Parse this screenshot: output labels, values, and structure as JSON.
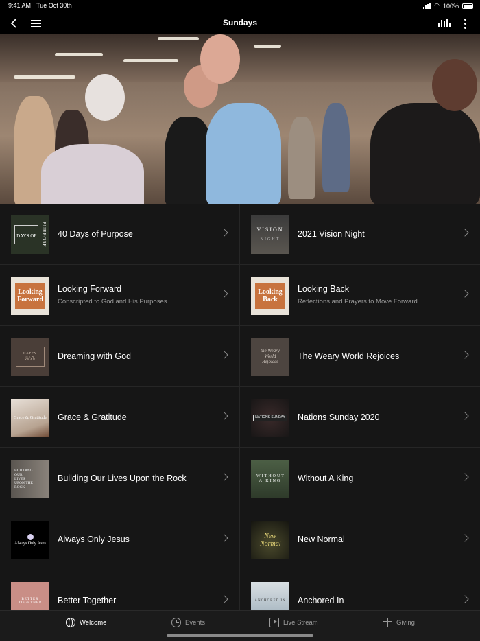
{
  "status_bar": {
    "time": "9:41 AM",
    "date": "Tue Oct 30th",
    "battery": "100%"
  },
  "nav": {
    "title": "Sundays"
  },
  "items": [
    {
      "title": "40 Days of Purpose",
      "subtitle": ""
    },
    {
      "title": "2021 Vision Night",
      "subtitle": ""
    },
    {
      "title": "Looking Forward",
      "subtitle": "Conscripted to God and His Purposes"
    },
    {
      "title": "Looking Back",
      "subtitle": "Reflections and Prayers to Move Forward"
    },
    {
      "title": "Dreaming with God",
      "subtitle": ""
    },
    {
      "title": "The Weary World Rejoices",
      "subtitle": ""
    },
    {
      "title": "Grace & Gratitude",
      "subtitle": ""
    },
    {
      "title": "Nations Sunday 2020",
      "subtitle": ""
    },
    {
      "title": "Building Our Lives Upon the Rock",
      "subtitle": ""
    },
    {
      "title": "Without A King",
      "subtitle": ""
    },
    {
      "title": "Always Only Jesus",
      "subtitle": ""
    },
    {
      "title": "New Normal",
      "subtitle": ""
    },
    {
      "title": "Better Together",
      "subtitle": ""
    },
    {
      "title": "Anchored In",
      "subtitle": ""
    }
  ],
  "thumbs": {
    "t0": "DAYS OF",
    "t0b": "PURPOSE",
    "t1": "VISION",
    "t1b": "NIGHT",
    "t2": "Looking Forward",
    "t3": "Looking Back",
    "t4": "HAPPY NEW YEAR",
    "t5": "the Weary World Rejoices",
    "t6": "Grace & Gratitude",
    "t7": "NATIONS SUNDAY",
    "t8": "BUILDING OUR LIVES UPON THE ROCK",
    "t9": "WITHOUT A KING",
    "t10": "Always Only Jesus",
    "t11": "New Normal",
    "t12": "BETTER TOGETHER",
    "t13": "ANCHORED IN"
  },
  "tabs": [
    {
      "label": "Welcome",
      "icon": "globe-icon",
      "active": true
    },
    {
      "label": "Events",
      "icon": "clock-icon",
      "active": false
    },
    {
      "label": "Live Stream",
      "icon": "play-screen-icon",
      "active": false
    },
    {
      "label": "Giving",
      "icon": "gift-icon",
      "active": false
    }
  ],
  "colors": {
    "background": "#141414",
    "tab_active": "#ffffff",
    "tab_inactive": "#9a9a9a",
    "subtitle": "#9a9a9a"
  }
}
